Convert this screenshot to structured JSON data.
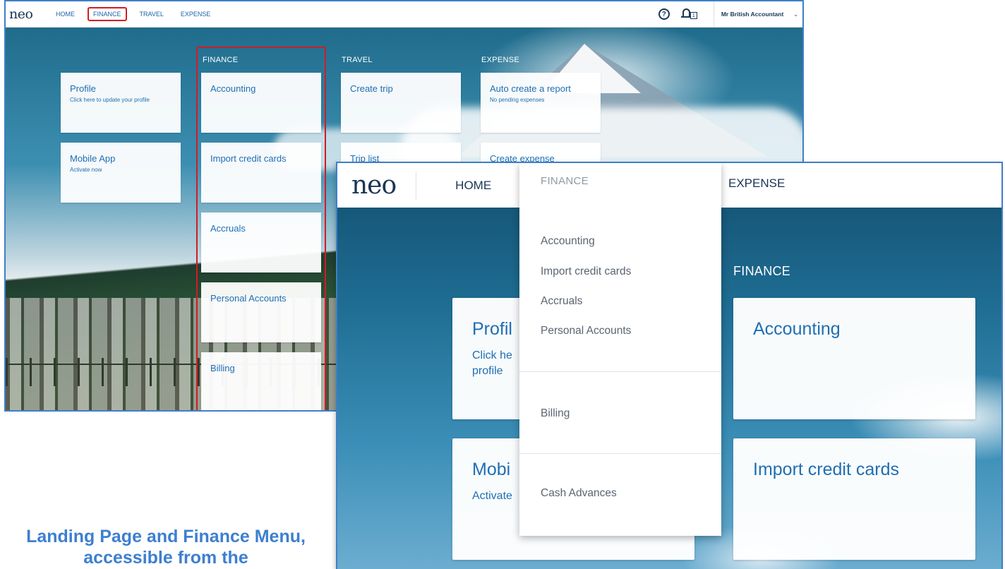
{
  "back_screenshot": {
    "logo": "neo",
    "nav": [
      "HOME",
      "FINANCE",
      "TRAVEL",
      "EXPENSE"
    ],
    "highlighted_nav": "FINANCE",
    "notification_count": "1",
    "user_name": "Mr British Accountant",
    "columns": {
      "home": {
        "tiles": [
          {
            "title": "Profile",
            "subtitle": "Click here to update your profile"
          },
          {
            "title": "Mobile App",
            "subtitle": "Activate now"
          }
        ]
      },
      "finance": {
        "heading": "FINANCE",
        "tiles": [
          {
            "title": "Accounting"
          },
          {
            "title": "Import credit cards"
          },
          {
            "title": "Accruals"
          },
          {
            "title": "Personal Accounts"
          },
          {
            "title": "Billing"
          }
        ]
      },
      "travel": {
        "heading": "TRAVEL",
        "tiles": [
          {
            "title": "Create trip"
          },
          {
            "title": "Trip list"
          }
        ]
      },
      "expense": {
        "heading": "EXPENSE",
        "tiles": [
          {
            "title": "Auto create a report",
            "subtitle": "No pending expenses"
          },
          {
            "title": "Create expense"
          }
        ]
      }
    }
  },
  "front_screenshot": {
    "logo": "neo",
    "nav_home": "HOME",
    "nav_expense": "EXPENSE",
    "finance_heading": "FINANCE",
    "tiles_left": [
      {
        "title": "Profil",
        "subtitle": "Click he profile"
      },
      {
        "title": "Mobi",
        "subtitle": "Activate"
      }
    ],
    "tiles_right": [
      {
        "title": "Accounting"
      },
      {
        "title": "Import credit cards"
      }
    ],
    "finance_menu": {
      "heading": "FINANCE",
      "group1": [
        "Accounting",
        "Import credit cards",
        "Accruals",
        "Personal Accounts"
      ],
      "group2": [
        "Billing"
      ],
      "group3": [
        "Cash Advances"
      ]
    }
  },
  "caption": "Landing Page and Finance Menu, accessible from the",
  "colors": {
    "accent_blue": "#1f6fb3",
    "navy": "#1b3556",
    "highlight_red": "#d21c24",
    "caption_blue": "#3d7fd0",
    "frame_blue": "#3f7fc6"
  },
  "icons": [
    "help-icon",
    "bell-icon",
    "chevron-down-icon"
  ]
}
